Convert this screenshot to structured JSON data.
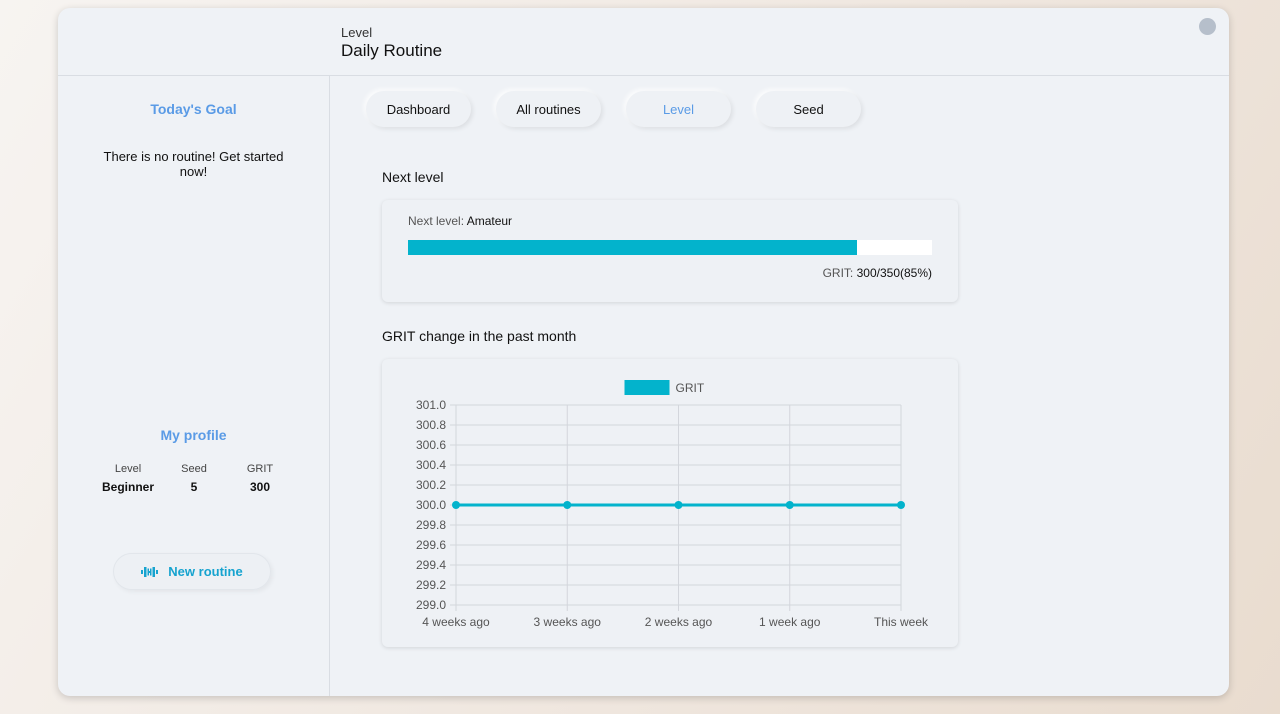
{
  "header": {
    "breadcrumb": "Level",
    "title": "Daily Routine"
  },
  "sidebar": {
    "goal_heading": "Today's Goal",
    "goal_empty_text": "There is no routine! Get started now!",
    "profile_heading": "My profile",
    "stats": [
      {
        "label": "Level",
        "value": "Beginner"
      },
      {
        "label": "Seed",
        "value": "5"
      },
      {
        "label": "GRIT",
        "value": "300"
      }
    ],
    "new_routine_label": "New routine",
    "new_routine_icon": "dumbbell-icon"
  },
  "tabs": [
    {
      "label": "Dashboard",
      "active": false
    },
    {
      "label": "All routines",
      "active": false
    },
    {
      "label": "Level",
      "active": true
    },
    {
      "label": "Seed",
      "active": false
    }
  ],
  "next_level": {
    "section_title": "Next level",
    "label_prefix": "Next level: ",
    "level_name": "Amateur",
    "grit_prefix": "GRIT: ",
    "grit_value": "300/350(85%)",
    "progress_fraction": 0.857
  },
  "grit_chart": {
    "section_title": "GRIT change in the past month"
  },
  "colors": {
    "accent": "#5a9be6",
    "progress": "#03b3cc",
    "button_text": "#16a3cf"
  },
  "chart_data": {
    "type": "line",
    "categories": [
      "4 weeks ago",
      "3 weeks ago",
      "2 weeks ago",
      "1 week ago",
      "This week"
    ],
    "series": [
      {
        "name": "GRIT",
        "values": [
          300,
          300,
          300,
          300,
          300
        ],
        "color": "#03b3cc"
      }
    ],
    "ylim": [
      299.0,
      301.0
    ],
    "yticks": [
      "301.0",
      "300.8",
      "300.6",
      "300.4",
      "300.2",
      "300.0",
      "299.8",
      "299.6",
      "299.4",
      "299.2",
      "299.0"
    ],
    "grid": true,
    "legend": "top"
  }
}
